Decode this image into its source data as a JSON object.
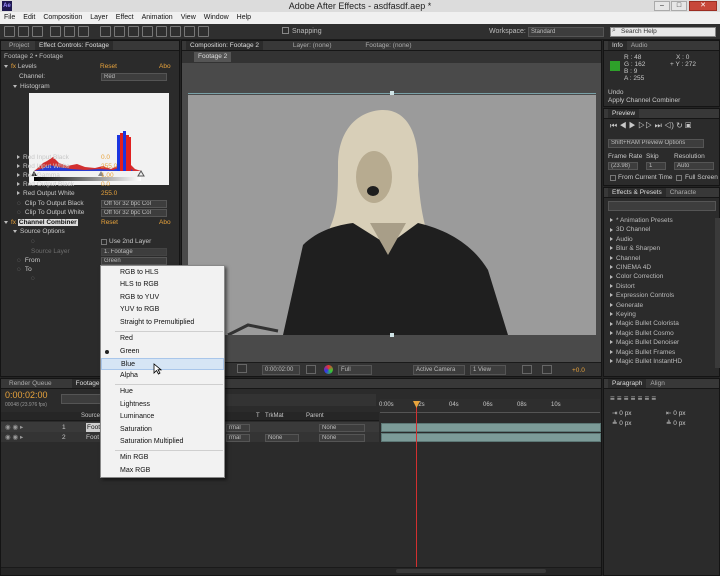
{
  "window": {
    "title": "Adobe After Effects - asdfasdf.aep *",
    "min": "–",
    "max": "□",
    "close": "✕"
  },
  "menu": [
    "File",
    "Edit",
    "Composition",
    "Layer",
    "Effect",
    "Animation",
    "View",
    "Window",
    "Help"
  ],
  "toolbar": {
    "snapping": "Snapping",
    "workspace_label": "Workspace:",
    "workspace_value": "Standard",
    "search_placeholder": "Search Help"
  },
  "left_panel": {
    "tabs": [
      "Project",
      "Effect Controls: Footage"
    ],
    "path": "Footage 2 • Footage",
    "levels": {
      "name": "Levels",
      "reset": "Reset",
      "about": "Abo",
      "channel_label": "Channel:",
      "channel_value": "Red",
      "histogram": "Histogram"
    },
    "props": [
      {
        "label": "Red Input Black",
        "value": "0.0"
      },
      {
        "label": "Red Input White",
        "value": "255.0"
      },
      {
        "label": "Red Gamma",
        "value": "1.00"
      },
      {
        "label": "Red Output Black",
        "value": "0.0"
      },
      {
        "label": "Red Output White",
        "value": "255.0"
      }
    ],
    "clip_black": {
      "label": "Clip To Output Black",
      "value": "Off for 32 bpc Col"
    },
    "clip_white": {
      "label": "Clip To Output White",
      "value": "Off for 32 bpc Col"
    },
    "cc": {
      "name": "Channel Combiner",
      "reset": "Reset",
      "about": "Abo",
      "source_options": "Source Options",
      "use_2nd": "Use 2nd Layer",
      "source_layer": "Source Layer",
      "source_layer_value": "1. Footage",
      "from": "From",
      "from_value": "Green",
      "to": "To"
    }
  },
  "dropdown": {
    "g1": [
      "RGB to HLS",
      "HLS to RGB",
      "RGB to YUV",
      "YUV to RGB",
      "Straight to Premultiplied"
    ],
    "g2": [
      "Red",
      "Green",
      "Blue",
      "Alpha"
    ],
    "g3": [
      "Hue",
      "Lightness",
      "Luminance",
      "Saturation",
      "Saturation Multiplied"
    ],
    "g4": [
      "Min RGB",
      "Max RGB"
    ],
    "checked": "Green",
    "highlighted": "Blue"
  },
  "composition": {
    "tabs": [
      "Composition: Footage 2",
      "Layer: (none)",
      "Footage: (none)"
    ],
    "comp_tab": "Footage 2",
    "timecode": "0:00:02:00",
    "quality": "Full",
    "camera": "Active Camera",
    "views": "1 View",
    "exposure": "+0.0"
  },
  "info": {
    "tabs": [
      "Info",
      "Audio"
    ],
    "r": "R : 48",
    "g": "G : 162",
    "b": "B : 9",
    "a": "A : 255",
    "x": "X : 0",
    "y": "Y : 272",
    "undo": "Undo",
    "action": "Apply Channel Combiner"
  },
  "preview": {
    "tab": "Preview",
    "options": "Shift+RAM Preview Options",
    "frame_rate_label": "Frame Rate",
    "skip_label": "Skip",
    "resolution_label": "Resolution",
    "frame_rate": "(23.98)",
    "skip": "1",
    "resolution": "Auto",
    "from_current": "From Current Time",
    "full_screen": "Full Screen"
  },
  "effects": {
    "tabs": [
      "Effects & Presets",
      "Characte"
    ],
    "items": [
      "* Animation Presets",
      "3D Channel",
      "Audio",
      "Blur & Sharpen",
      "Channel",
      "CINEMA 4D",
      "Color Correction",
      "Distort",
      "Expression Controls",
      "Generate",
      "Keying",
      "Magic Bullet Colorista",
      "Magic Bullet Cosmo",
      "Magic Bullet Denoiser",
      "Magic Bullet Frames",
      "Magic Bullet InstantHD"
    ]
  },
  "paragraph": {
    "tabs": [
      "Paragraph",
      "Align"
    ],
    "px": "px"
  },
  "timeline": {
    "tabs": [
      "Render Queue",
      "Footage 2"
    ],
    "timecode": "0:00:02:00",
    "fps": "00048 (23.976 fps)",
    "cols": {
      "source": "Source N",
      "t": "T",
      "trkmat": "TrkMat",
      "parent": "Parent"
    },
    "layers": [
      {
        "num": "1",
        "name": "Foot",
        "mode": "rmal",
        "trk": "",
        "parent": "None"
      },
      {
        "num": "2",
        "name": "Foot",
        "mode": "rmal",
        "trk": "None",
        "parent": "None"
      }
    ],
    "ruler": [
      "0:00s",
      "02s",
      "04s",
      "06s",
      "08s",
      "10s"
    ]
  },
  "colors": {
    "accent": "#e8a33c",
    "highlight": "#d6e5f5",
    "track": "#7c9b98",
    "swatch": "#2ea12a"
  }
}
